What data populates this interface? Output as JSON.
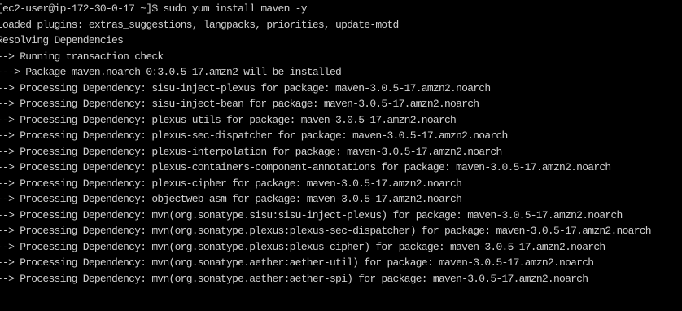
{
  "terminal": {
    "text_color": "#cfcfcf",
    "background_color": "#000000",
    "lines": [
      "[ec2-user@ip-172-30-0-17 ~]$ sudo yum install maven -y",
      "Loaded plugins: extras_suggestions, langpacks, priorities, update-motd",
      "Resolving Dependencies",
      "--> Running transaction check",
      "---> Package maven.noarch 0:3.0.5-17.amzn2 will be installed",
      "--> Processing Dependency: sisu-inject-plexus for package: maven-3.0.5-17.amzn2.noarch",
      "--> Processing Dependency: sisu-inject-bean for package: maven-3.0.5-17.amzn2.noarch",
      "--> Processing Dependency: plexus-utils for package: maven-3.0.5-17.amzn2.noarch",
      "--> Processing Dependency: plexus-sec-dispatcher for package: maven-3.0.5-17.amzn2.noarch",
      "--> Processing Dependency: plexus-interpolation for package: maven-3.0.5-17.amzn2.noarch",
      "--> Processing Dependency: plexus-containers-component-annotations for package: maven-3.0.5-17.amzn2.noarch",
      "--> Processing Dependency: plexus-cipher for package: maven-3.0.5-17.amzn2.noarch",
      "--> Processing Dependency: objectweb-asm for package: maven-3.0.5-17.amzn2.noarch",
      "--> Processing Dependency: mvn(org.sonatype.sisu:sisu-inject-plexus) for package: maven-3.0.5-17.amzn2.noarch",
      "--> Processing Dependency: mvn(org.sonatype.plexus:plexus-sec-dispatcher) for package: maven-3.0.5-17.amzn2.noarch",
      "--> Processing Dependency: mvn(org.sonatype.plexus:plexus-cipher) for package: maven-3.0.5-17.amzn2.noarch",
      "--> Processing Dependency: mvn(org.sonatype.aether:aether-util) for package: maven-3.0.5-17.amzn2.noarch",
      "--> Processing Dependency: mvn(org.sonatype.aether:aether-spi) for package: maven-3.0.5-17.amzn2.noarch"
    ]
  }
}
